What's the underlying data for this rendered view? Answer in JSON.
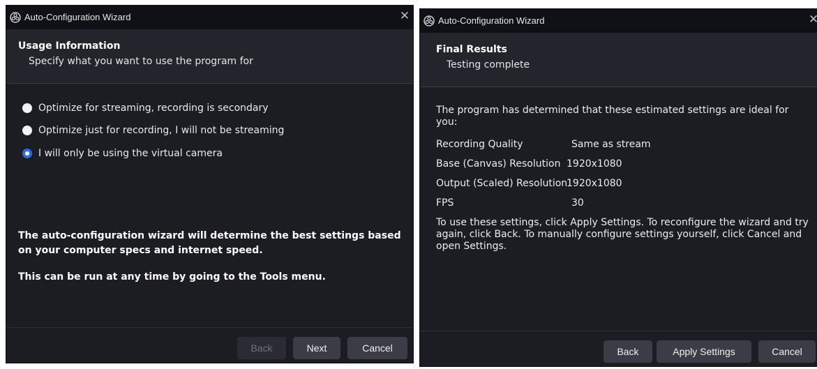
{
  "left_window": {
    "title": "Auto-Configuration Wizard",
    "close_glyph": "✕",
    "header": {
      "title": "Usage Information",
      "subtitle": "Specify what you want to use the program for"
    },
    "options": [
      {
        "label": "Optimize for streaming, recording is secondary",
        "checked": false
      },
      {
        "label": "Optimize just for recording, I will not be streaming",
        "checked": false
      },
      {
        "label": "I will only be using the virtual camera",
        "checked": true
      }
    ],
    "info_line_1": "The auto-configuration wizard will determine the best settings based on your computer specs and internet speed.",
    "info_line_2": "This can be run at any time by going to the Tools menu.",
    "buttons": {
      "back": "Back",
      "next": "Next",
      "cancel": "Cancel"
    }
  },
  "right_window": {
    "title": "Auto-Configuration Wizard",
    "close_glyph": "✕",
    "header": {
      "title": "Final Results",
      "subtitle": "Testing complete"
    },
    "intro": "The program has determined that these estimated settings are ideal for you:",
    "settings": [
      {
        "label": "Recording Quality",
        "value": "Same as stream"
      },
      {
        "label": "Base (Canvas) Resolution",
        "value": "1920x1080"
      },
      {
        "label": "Output (Scaled) Resolution",
        "value": "1920x1080"
      },
      {
        "label": "FPS",
        "value": "30"
      }
    ],
    "instructions": "To use these settings, click Apply Settings. To reconfigure the wizard and try again, click Back. To manually configure settings yourself, click Cancel and open Settings.",
    "buttons": {
      "back": "Back",
      "apply": "Apply Settings",
      "cancel": "Cancel"
    }
  },
  "colors": {
    "accent": "#2c6ed9",
    "window_bg": "#1c1d23",
    "titlebar_bg": "#101116",
    "header_bg": "#24252c",
    "button_bg": "#3b3c46"
  },
  "icons": {
    "app": "obs-logo-icon",
    "close": "close-icon"
  }
}
